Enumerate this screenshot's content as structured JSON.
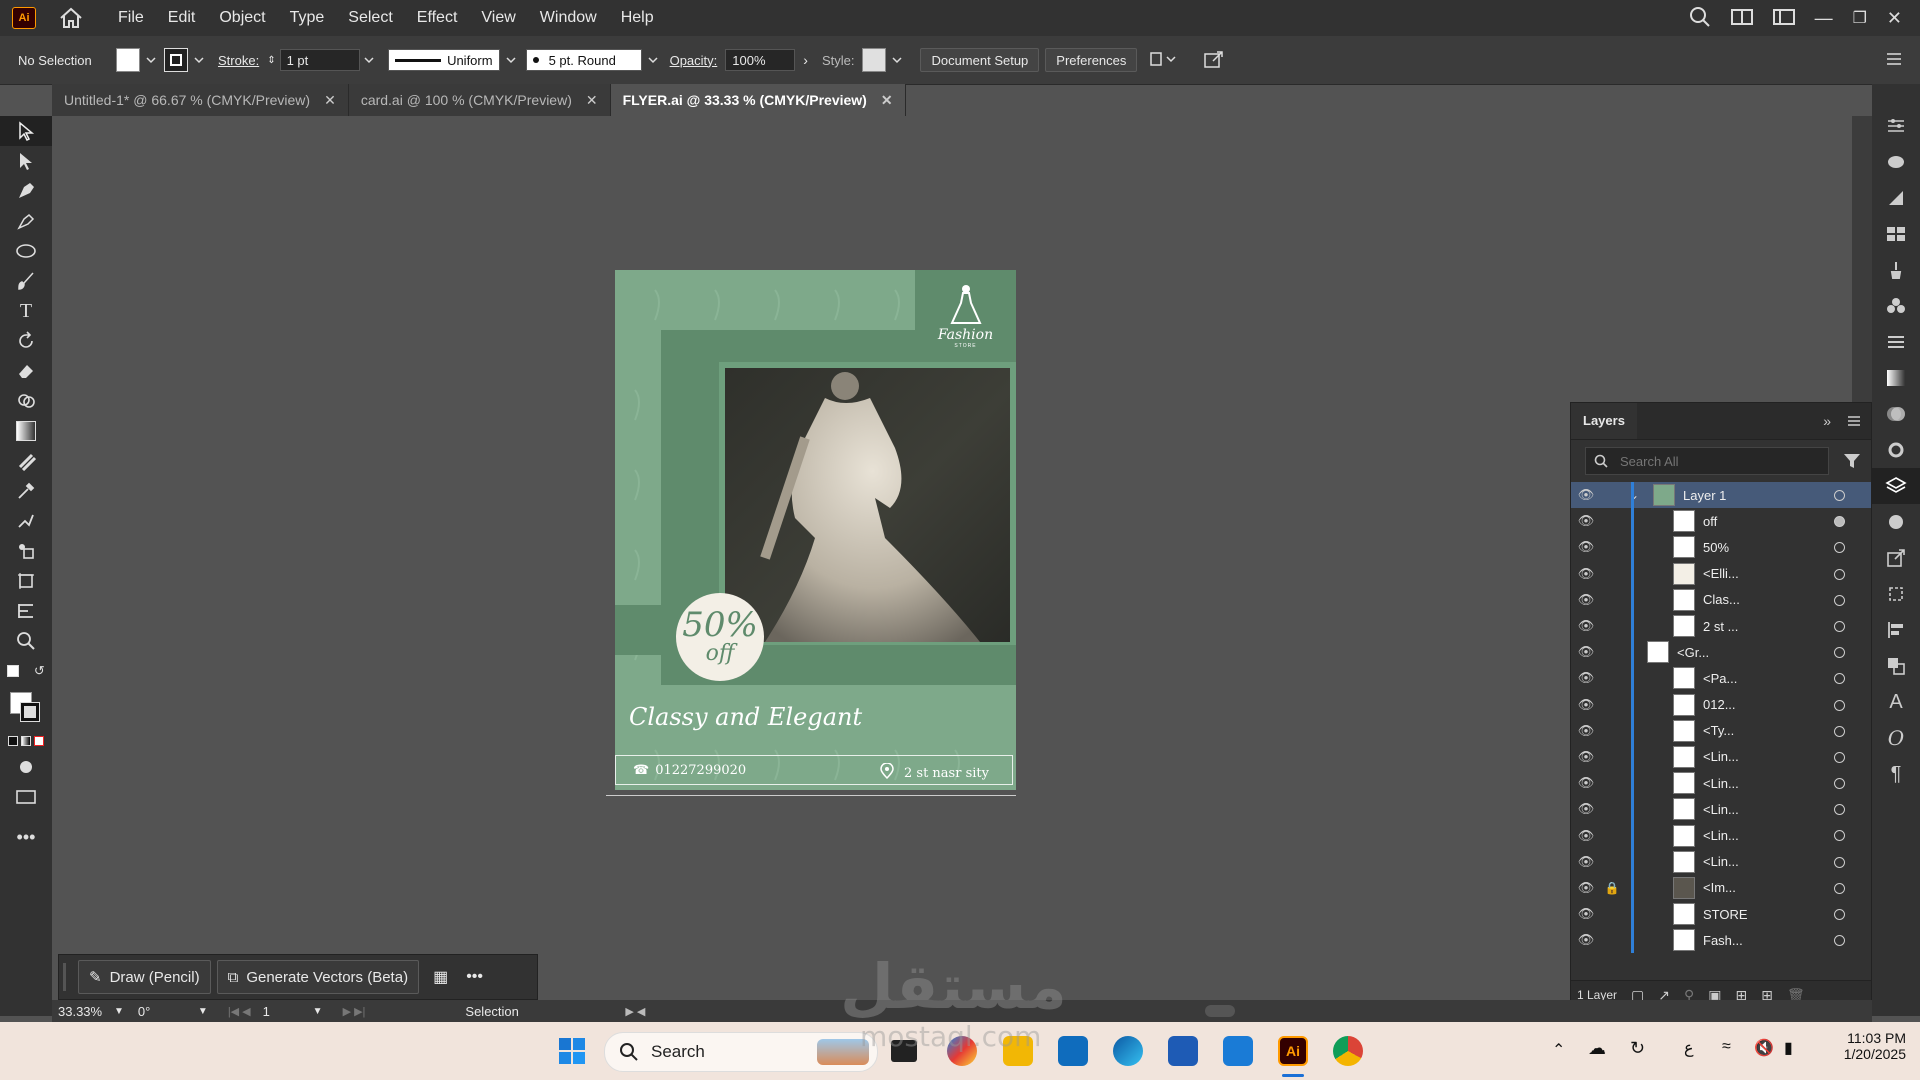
{
  "menubar": {
    "app_badge": "Ai",
    "items": [
      "File",
      "Edit",
      "Object",
      "Type",
      "Select",
      "Effect",
      "View",
      "Window",
      "Help"
    ]
  },
  "controlbar": {
    "selection": "No Selection",
    "stroke_label": "Stroke:",
    "stroke_value": "1 pt",
    "profile": "Uniform",
    "brush": "5 pt. Round",
    "opacity_label": "Opacity:",
    "opacity_value": "100%",
    "style_label": "Style:",
    "document_setup": "Document Setup",
    "preferences": "Preferences"
  },
  "tabs": [
    {
      "label": "Untitled-1* @ 66.67 % (CMYK/Preview)",
      "active": false
    },
    {
      "label": "card.ai @ 100 % (CMYK/Preview)",
      "active": false
    },
    {
      "label": "FLYER.ai @ 33.33 % (CMYK/Preview)",
      "active": true
    }
  ],
  "flyer": {
    "discount_big": "50%",
    "discount_small": "off",
    "headline": "Classy and Elegant",
    "phone": "01227299020",
    "address": "2 st nasr sity",
    "brand": "Fashion",
    "brand_sub": "STORE",
    "colors": {
      "green": "#7ea98a",
      "dark_green": "#5e8a6b",
      "photo_bg": "#3a3b35"
    }
  },
  "layers": {
    "title": "Layers",
    "search_placeholder": "Search All",
    "footer_count": "1 Layer",
    "rows": [
      {
        "name": "Layer 1",
        "top": true
      },
      {
        "name": "off"
      },
      {
        "name": "50%"
      },
      {
        "name": "<Elli..."
      },
      {
        "name": "Clas..."
      },
      {
        "name": "2 st ..."
      },
      {
        "name": "<Gr..."
      },
      {
        "name": "<Pa..."
      },
      {
        "name": "012..."
      },
      {
        "name": "<Ty..."
      },
      {
        "name": "<Lin..."
      },
      {
        "name": "<Lin..."
      },
      {
        "name": "<Lin..."
      },
      {
        "name": "<Lin..."
      },
      {
        "name": "<Lin..."
      },
      {
        "name": "<Im...",
        "locked": true
      },
      {
        "name": "STORE"
      },
      {
        "name": "Fash..."
      }
    ]
  },
  "contextbar": {
    "draw": "Draw (Pencil)",
    "generate": "Generate Vectors (Beta)"
  },
  "statusbar": {
    "zoom": "33.33%",
    "rotation": "0°",
    "artboard": "1",
    "tool": "Selection"
  },
  "taskbar": {
    "search": "Search",
    "time": "11:03 PM",
    "date": "1/20/2025",
    "lang": "ع"
  },
  "watermark": "مستقل",
  "watermark_sub": "mostaql.com"
}
